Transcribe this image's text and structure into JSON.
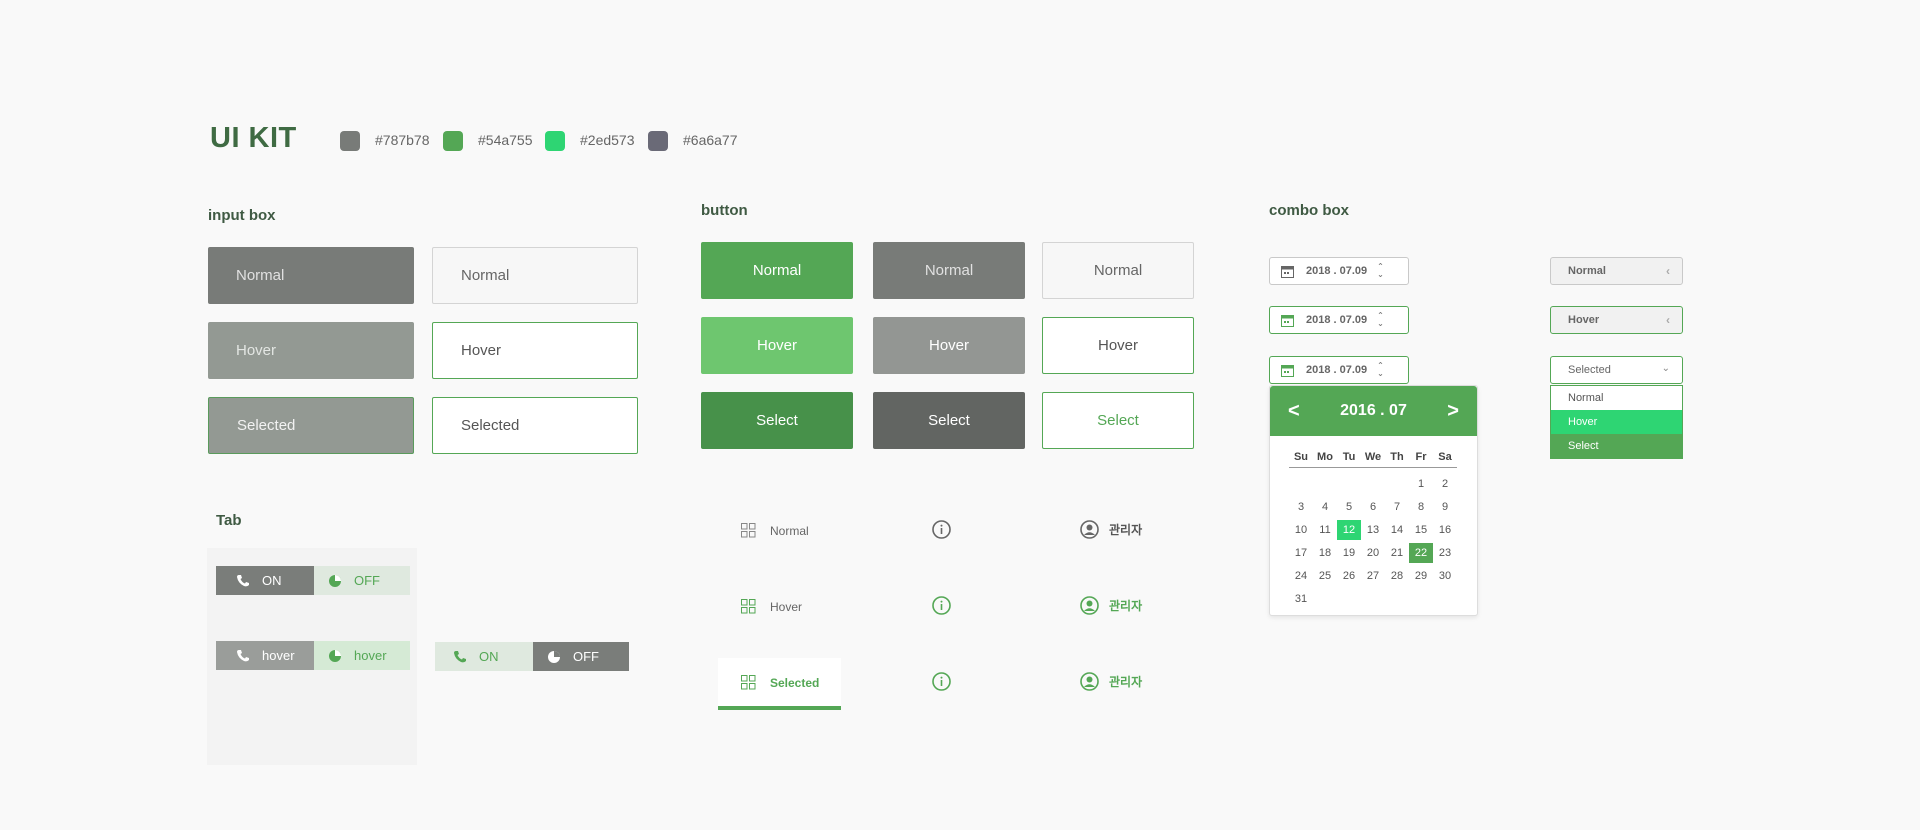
{
  "title": "UI KIT",
  "colors": [
    {
      "hex": "#787b78",
      "label": "#787b78"
    },
    {
      "hex": "#54a755",
      "label": "#54a755"
    },
    {
      "hex": "#2ed573",
      "label": "#2ed573"
    },
    {
      "hex": "#6a6a77",
      "label": "#6a6a77"
    }
  ],
  "input_box": {
    "heading": "input box",
    "filled": [
      "Normal",
      "Hover",
      "Selected"
    ],
    "outlined": [
      "Normal",
      "Hover",
      "Selected"
    ]
  },
  "button": {
    "heading": "button",
    "green": [
      "Normal",
      "Hover",
      "Select"
    ],
    "gray": [
      "Normal",
      "Hover",
      "Select"
    ],
    "outline": [
      "Normal",
      "Hover",
      "Select"
    ]
  },
  "tab": {
    "heading": "Tab",
    "row1": {
      "on": "ON",
      "off": "OFF"
    },
    "row2": {
      "on": "hover",
      "off": "hover"
    },
    "row3": {
      "on": "ON",
      "off": "OFF"
    }
  },
  "nav_tabs": {
    "labels": [
      "Normal",
      "Hover",
      "Selected"
    ],
    "user_label": "관리자"
  },
  "combo_box": {
    "heading": "combo box",
    "date_value": "2018 . 07.09",
    "combo_labels": [
      "Normal",
      "Hover",
      "Selected"
    ],
    "dropdown_options": [
      "Normal",
      "Hover",
      "Select"
    ]
  },
  "calendar": {
    "prev": "<",
    "next": ">",
    "month_label": "2016 . 07",
    "weekdays": [
      "Su",
      "Mo",
      "Tu",
      "We",
      "Th",
      "Fr",
      "Sa"
    ],
    "weeks": [
      [
        "",
        "",
        "",
        "",
        "",
        "1",
        "2"
      ],
      [
        "3",
        "4",
        "5",
        "6",
        "7",
        "8",
        "9"
      ],
      [
        "10",
        "11",
        "12",
        "13",
        "14",
        "15",
        "16"
      ],
      [
        "17",
        "18",
        "19",
        "20",
        "21",
        "22",
        "23"
      ],
      [
        "24",
        "25",
        "26",
        "27",
        "28",
        "29",
        "30"
      ],
      [
        "31",
        "",
        "",
        "",
        "",
        "",
        ""
      ]
    ],
    "today": "12",
    "selected": "22"
  }
}
